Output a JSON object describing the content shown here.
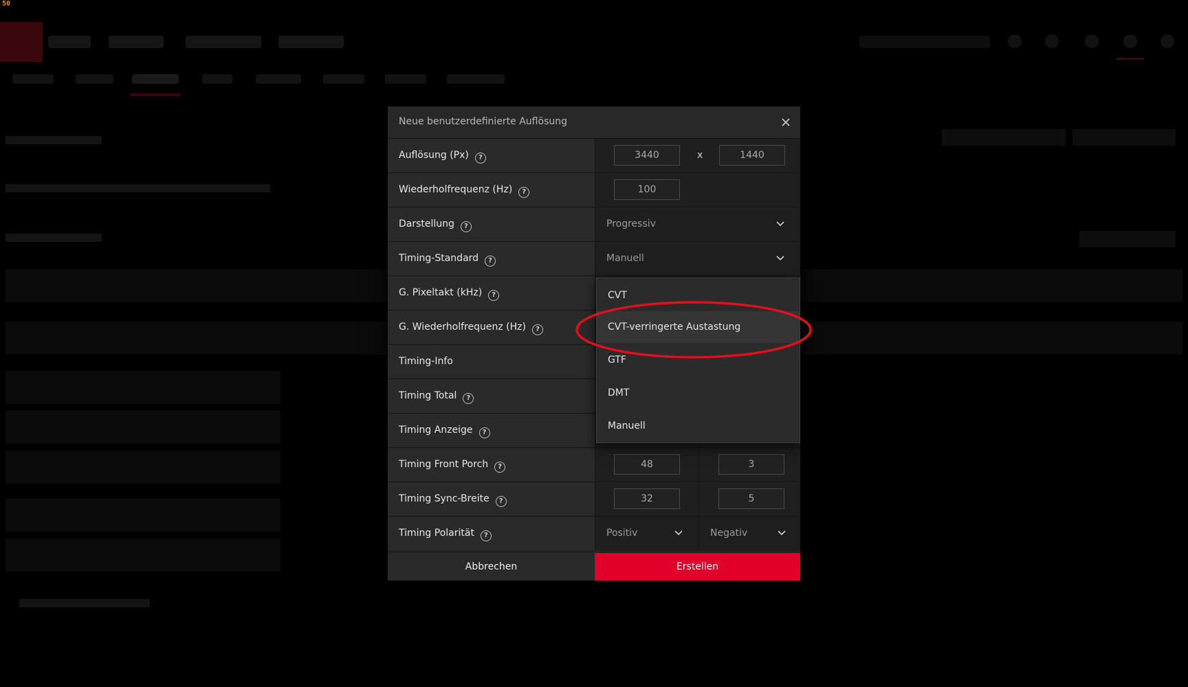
{
  "overlay": {
    "fps_counter": "50"
  },
  "dialog": {
    "title": "Neue benutzerdefinierte Auflösung",
    "rows": {
      "resolution": {
        "label": "Auflösung (Px)",
        "width": "3440",
        "separator": "x",
        "height": "1440"
      },
      "refresh": {
        "label": "Wiederholfrequenz (Hz)",
        "value": "100"
      },
      "scan": {
        "label": "Darstellung",
        "value": "Progressiv"
      },
      "timing_standard": {
        "label": "Timing-Standard",
        "value": "Manuell"
      },
      "pixel_clock": {
        "label": "G. Pixeltakt (kHz)"
      },
      "eff_refresh": {
        "label": "G. Wiederholfrequenz (Hz)"
      },
      "timing_info": {
        "label": "Timing-Info"
      },
      "timing_total": {
        "label": "Timing Total"
      },
      "timing_display": {
        "label": "Timing Anzeige"
      },
      "front_porch": {
        "label": "Timing Front Porch",
        "h": "48",
        "v": "3"
      },
      "sync_width": {
        "label": "Timing Sync-Breite",
        "h": "32",
        "v": "5"
      },
      "polarity": {
        "label": "Timing Polarität",
        "h": "Positiv",
        "v": "Negativ"
      }
    },
    "help_glyph": "?",
    "cancel_label": "Abbrechen",
    "create_label": "Erstellen"
  },
  "dropdown": {
    "options": [
      "CVT",
      "CVT-verringerte Austastung",
      "GTF",
      "DMT",
      "Manuell"
    ],
    "highlighted_index": 1
  },
  "colors": {
    "accent": "#e0002a",
    "annotation": "#e0101e"
  }
}
